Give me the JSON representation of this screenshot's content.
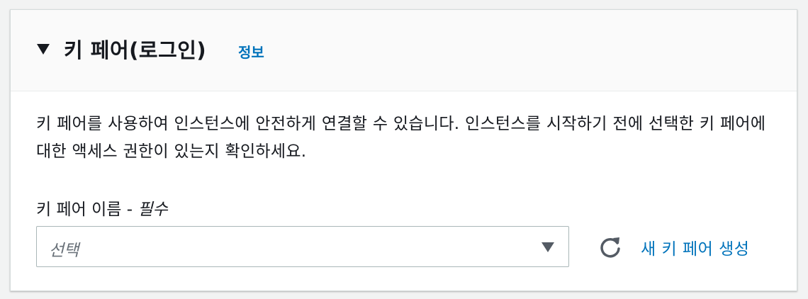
{
  "section": {
    "title": "키 페어(로그인)",
    "info_link": "정보",
    "description": "키 페어를 사용하여 인스턴스에 안전하게 연결할 수 있습니다. 인스턴스를 시작하기 전에 선택한 키 페어에 대한 액세스 권한이 있는지 확인하세요."
  },
  "key_pair_field": {
    "label": "키 페어 이름 - ",
    "required_text": "필수",
    "placeholder": "선택"
  },
  "actions": {
    "create_new_label": "새 키 페어 생성"
  },
  "icons": {
    "expand": "caret-down-icon",
    "dropdown": "caret-down-icon",
    "refresh": "refresh-icon"
  },
  "colors": {
    "link": "#0073bb",
    "text": "#16191f",
    "header_bg": "#fafafa"
  }
}
